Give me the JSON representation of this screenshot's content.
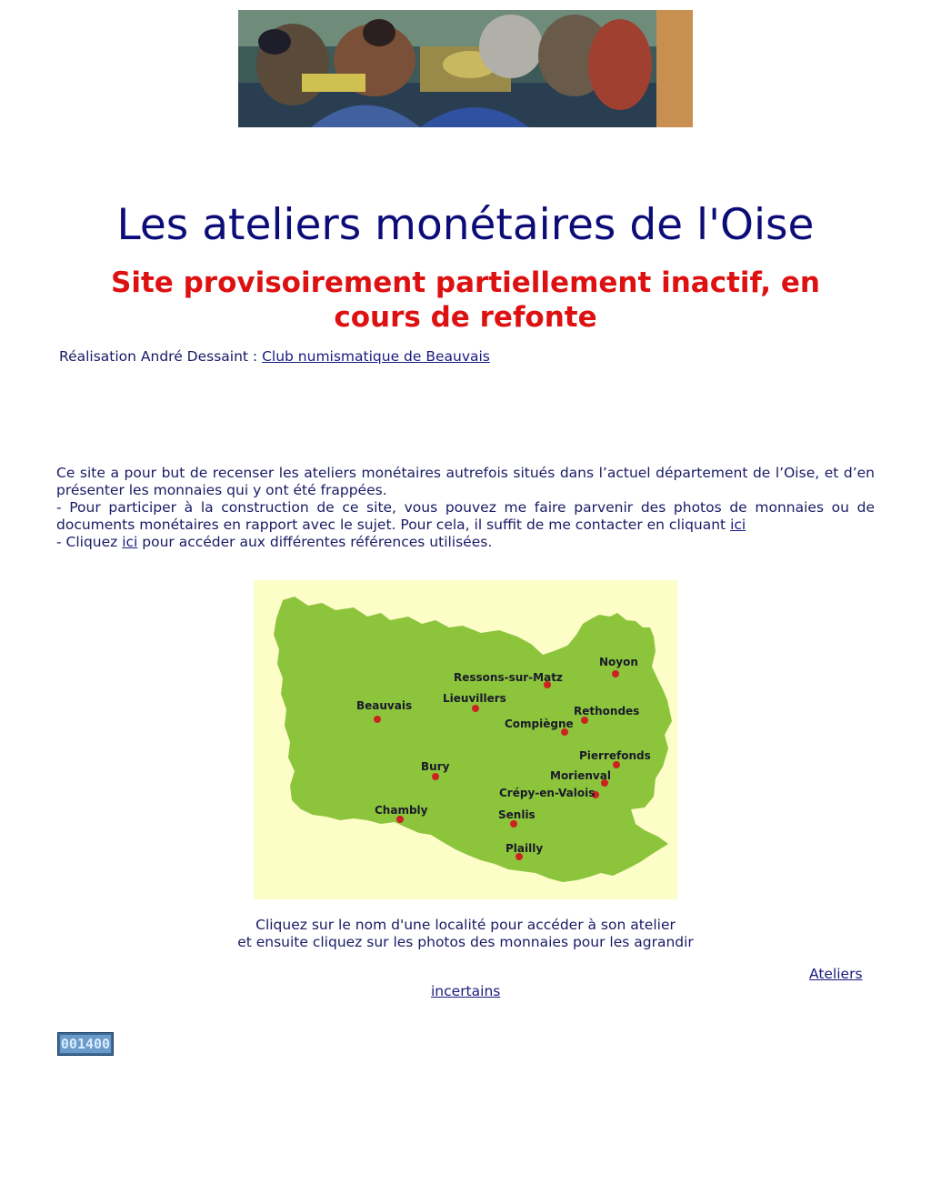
{
  "banner": {
    "alt": "Illustration ancienne d'un atelier monétaire"
  },
  "title": "Les ateliers monétaires de l'Oise",
  "subtitle": "Site provisoirement partiellement inactif, en cours de refonte",
  "credit": {
    "prefix": "Réalisation André Dessaint : ",
    "link": "Club numismatique de Beauvais"
  },
  "intro": {
    "line1": "Ce site a pour but de recenser les ateliers monétaires autrefois  situés dans l’actuel département de l’Oise, et d’en présenter les monnaies qui y ont été frappées.",
    "line2_text": "- Pour participer à la construction de ce site, vous pouvez me faire parvenir des photos de monnaies ou de documents monétaires en rapport avec le sujet. Pour cela, il suffit de me contacter en cliquant ",
    "line2_link": "ici ",
    "line3_prefix": "- Cliquez ",
    "line3_link": "ici",
    "line3_suffix": " pour accéder aux différentes références utilisées."
  },
  "map": {
    "colors": {
      "background": "#fdfdc8",
      "region": "#8cc43c",
      "dot": "#cc2222"
    },
    "towns": {
      "noyon": "Noyon",
      "ressons": "Ressons-sur-Matz",
      "lieuvillers": "Lieuvillers",
      "beauvais": "Beauvais",
      "rethondes": "Rethondes",
      "compiegne": "Compiègne",
      "pierrefonds": "Pierrefonds",
      "bury": "Bury",
      "morienval": "Morienval",
      "crepy": "Crépy-en-Valois",
      "chambly": "Chambly",
      "senlis": "Senlis",
      "plailly": "Plailly"
    }
  },
  "instructions": {
    "line1": "Cliquez sur le nom d'une  localité pour accéder à son atelier",
    "line2": "et ensuite cliquez sur les photos des monnaies pour les agrandir"
  },
  "ateliers_incertains": {
    "part1": "Ateliers",
    "part2": "incertains"
  },
  "counter": "001400"
}
